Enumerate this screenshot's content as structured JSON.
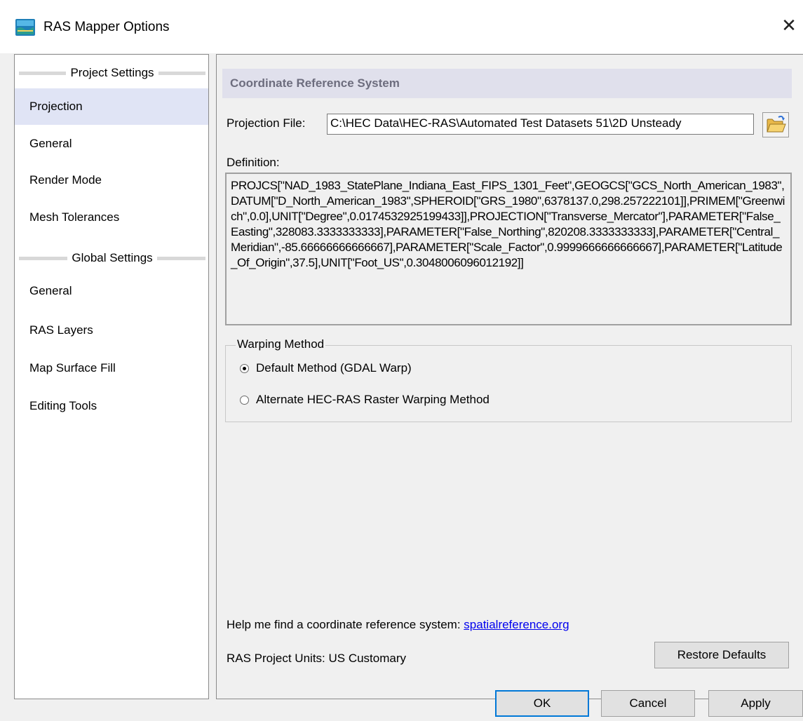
{
  "window": {
    "title": "RAS Mapper Options",
    "close_glyph": "✕",
    "app_icon": "ras-mapper-icon"
  },
  "sidebar": {
    "groups": [
      {
        "label": "Project Settings",
        "items": [
          "Projection",
          "General",
          "Render Mode",
          "Mesh Tolerances"
        ]
      },
      {
        "label": "Global Settings",
        "items": [
          "General",
          "RAS Layers",
          "Map Surface Fill",
          "Editing Tools"
        ]
      }
    ],
    "selected": "Projection"
  },
  "crs": {
    "header": "Coordinate Reference System",
    "projection_label": "Projection File:",
    "projection_value": "C:\\HEC Data\\HEC-RAS\\Automated Test Datasets 51\\2D Unsteady",
    "folder_icon": "open-folder-icon",
    "definition_label": "Definition:",
    "definition_text": "PROJCS[\"NAD_1983_StatePlane_Indiana_East_FIPS_1301_Feet\",GEOGCS[\"GCS_North_American_1983\",DATUM[\"D_North_American_1983\",SPHEROID[\"GRS_1980\",6378137.0,298.257222101]],PRIMEM[\"Greenwich\",0.0],UNIT[\"Degree\",0.0174532925199433]],PROJECTION[\"Transverse_Mercator\"],PARAMETER[\"False_Easting\",328083.3333333333],PARAMETER[\"False_Northing\",820208.3333333333],PARAMETER[\"Central_Meridian\",-85.66666666666667],PARAMETER[\"Scale_Factor\",0.9999666666666667],PARAMETER[\"Latitude_Of_Origin\",37.5],UNIT[\"Foot_US\",0.3048006096012192]]"
  },
  "warping": {
    "legend": "Warping Method",
    "options": [
      "Default Method (GDAL Warp)",
      "Alternate HEC-RAS Raster Warping Method"
    ],
    "selected_index": 0
  },
  "help": {
    "text": "Help me find a coordinate reference system:",
    "link": "spatialreference.org"
  },
  "units": "RAS Project Units: US Customary",
  "buttons": {
    "restore": "Restore Defaults",
    "ok": "OK",
    "cancel": "Cancel",
    "apply": "Apply"
  },
  "colors": {
    "selected_nav": "#e0e4f5",
    "header_band": "#e0e0ec",
    "link": "#0000ee",
    "focus_border": "#0078d7"
  }
}
